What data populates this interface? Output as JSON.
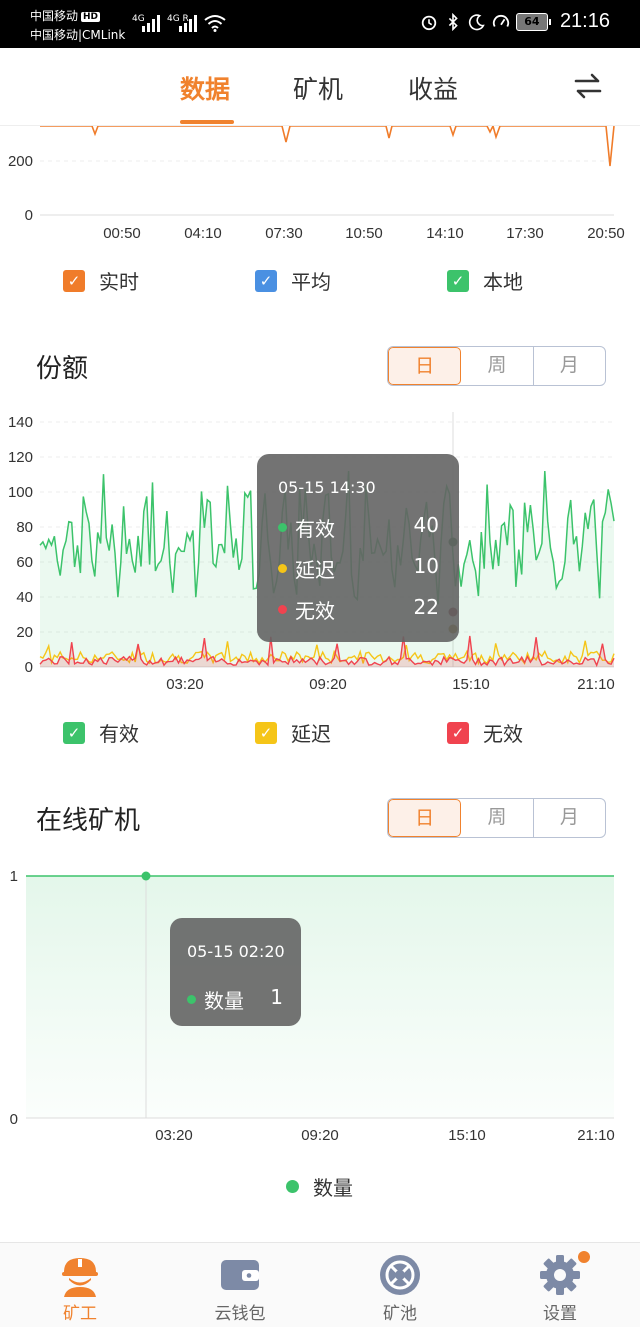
{
  "status_bar": {
    "carrier_line1": "中国移动",
    "hd": "HD",
    "carrier_line2": "中国移动|CMLink",
    "signal1": "4G",
    "signal2": "4G R",
    "battery": "64",
    "time": "21:16"
  },
  "nav": {
    "tabs": [
      {
        "label": "数据",
        "active": true
      },
      {
        "label": "矿机",
        "active": false
      },
      {
        "label": "收益",
        "active": false
      }
    ],
    "swap_icon": "swap-arrows-icon"
  },
  "hashrate_chart": {
    "y_ticks": [
      "200",
      "0"
    ],
    "x_ticks": [
      "00:50",
      "04:10",
      "07:30",
      "10:50",
      "14:10",
      "17:30",
      "20:50"
    ],
    "legend": [
      {
        "label": "实时",
        "color": "#f07c2a"
      },
      {
        "label": "平均",
        "color": "#4a90e2"
      },
      {
        "label": "本地",
        "color": "#3cc36b"
      }
    ]
  },
  "shares": {
    "title": "份额",
    "periods": [
      "日",
      "周",
      "月"
    ],
    "active_period": 0,
    "y_ticks": [
      "140",
      "120",
      "100",
      "80",
      "60",
      "40",
      "20",
      "0"
    ],
    "x_ticks": [
      "03:20",
      "09:20",
      "15:10",
      "21:10"
    ],
    "tooltip": {
      "time": "05-15 14:30",
      "rows": [
        {
          "label": "有效",
          "value": "40",
          "color": "#3cc36b"
        },
        {
          "label": "延迟",
          "value": "10",
          "color": "#f5c518"
        },
        {
          "label": "无效",
          "value": "22",
          "color": "#f0434f"
        }
      ]
    },
    "legend": [
      {
        "label": "有效",
        "color": "#3cc36b"
      },
      {
        "label": "延迟",
        "color": "#f5c518"
      },
      {
        "label": "无效",
        "color": "#f0434f"
      }
    ]
  },
  "online_miners": {
    "title": "在线矿机",
    "periods": [
      "日",
      "周",
      "月"
    ],
    "active_period": 0,
    "y_ticks": [
      "1",
      "0"
    ],
    "x_ticks": [
      "03:20",
      "09:20",
      "15:10",
      "21:10"
    ],
    "tooltip": {
      "time": "05-15 02:20",
      "label": "数量",
      "value": "1",
      "color": "#3cc36b"
    },
    "legend": {
      "label": "数量",
      "color": "#3cc36b"
    }
  },
  "bottom_nav": [
    {
      "label": "矿工",
      "icon": "miner-helmet-icon",
      "active": true
    },
    {
      "label": "云钱包",
      "icon": "wallet-icon",
      "active": false
    },
    {
      "label": "矿池",
      "icon": "pool-icon",
      "active": false
    },
    {
      "label": "设置",
      "icon": "gear-icon",
      "active": false
    }
  ]
}
